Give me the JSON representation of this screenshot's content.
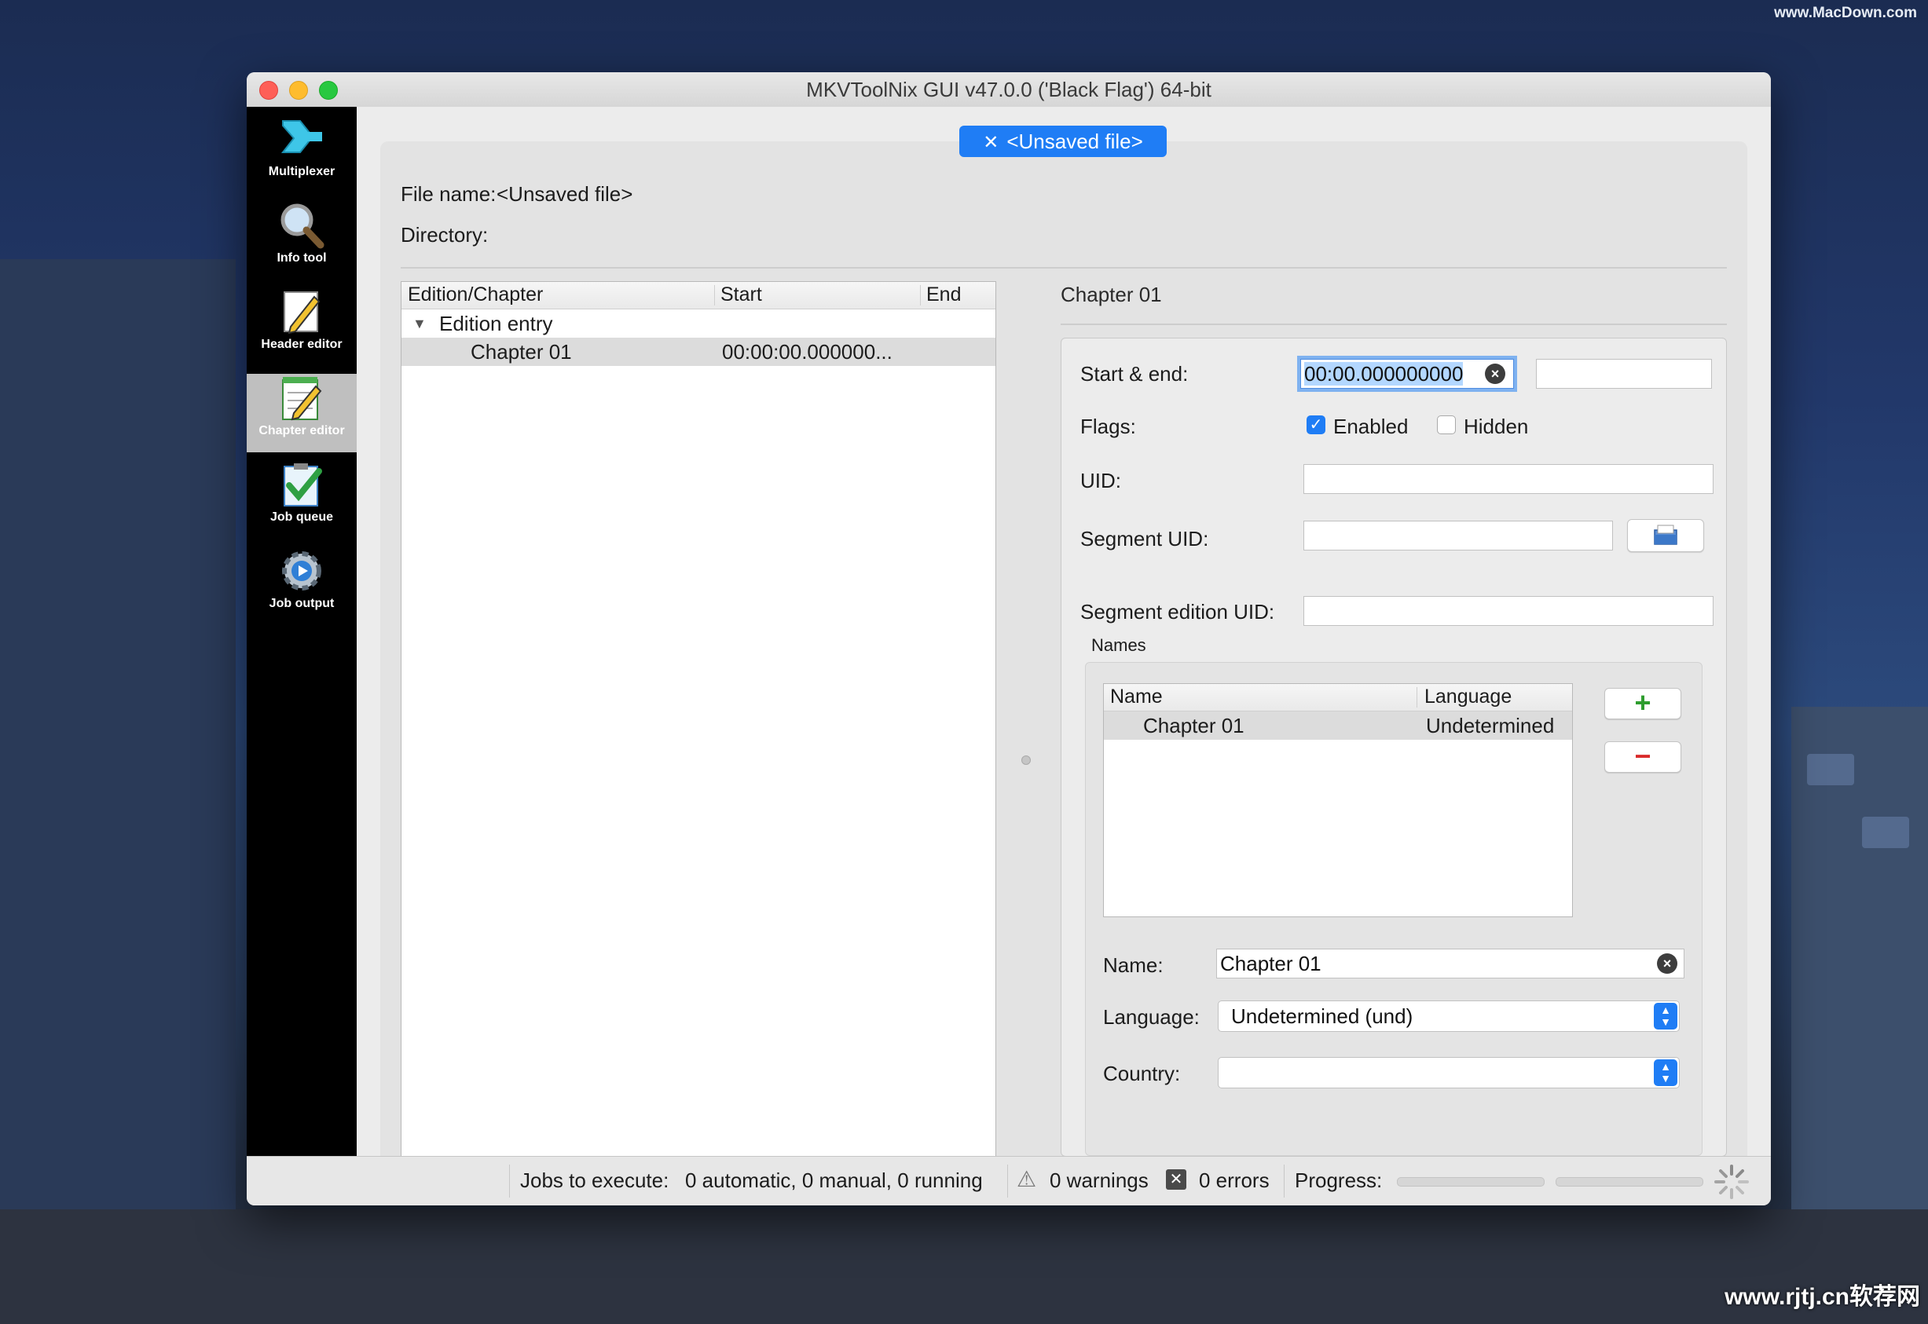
{
  "watermark": {
    "top": "www.MacDown.com",
    "bottom": "www.rjtj.cn软荐网"
  },
  "window": {
    "title": "MKVToolNix GUI v47.0.0 ('Black Flag') 64-bit"
  },
  "sidebar": {
    "items": [
      {
        "label": "Multiplexer",
        "icon": "multiplexer-icon"
      },
      {
        "label": "Info tool",
        "icon": "magnifier-icon"
      },
      {
        "label": "Header editor",
        "icon": "pencil-icon"
      },
      {
        "label": "Chapter editor",
        "icon": "notepad-pencil-icon",
        "active": true
      },
      {
        "label": "Job queue",
        "icon": "checkmark-clipboard-icon"
      },
      {
        "label": "Job output",
        "icon": "gear-play-icon"
      }
    ]
  },
  "tab": {
    "close_glyph": "✕",
    "label": "<Unsaved file>"
  },
  "file_info": {
    "file_name_label": "File name:",
    "file_name_value": "<Unsaved file>",
    "directory_label": "Directory:"
  },
  "tree": {
    "columns": [
      "Edition/Chapter",
      "Start",
      "End"
    ],
    "rows": [
      {
        "name": "Edition entry",
        "start": "",
        "end": ""
      },
      {
        "name": "Chapter 01",
        "start": "00:00:00.000000...",
        "end": ""
      }
    ]
  },
  "detail": {
    "title": "Chapter 01",
    "start_end_label": "Start & end:",
    "start_value": "00:00.000000000",
    "end_value": "",
    "flags_label": "Flags:",
    "enabled_label": "Enabled",
    "enabled_checked": true,
    "hidden_label": "Hidden",
    "hidden_checked": false,
    "uid_label": "UID:",
    "uid_value": "",
    "segment_uid_label": "Segment UID:",
    "segment_uid_value": "",
    "segment_edition_uid_label": "Segment edition UID:",
    "segment_edition_uid_value": "",
    "names_group_label": "Names",
    "names_columns": [
      "Name",
      "Language"
    ],
    "names_rows": [
      {
        "name": "Chapter 01",
        "language": "Undetermined"
      }
    ],
    "add_glyph": "+",
    "remove_glyph": "−",
    "name_label": "Name:",
    "name_value": "Chapter 01",
    "language_label": "Language:",
    "language_value": "Undetermined (und)",
    "country_label": "Country:",
    "country_value": ""
  },
  "statusbar": {
    "jobs_label": "Jobs to execute:",
    "jobs_value": "0 automatic, 0 manual, 0 running",
    "warnings": "0 warnings",
    "errors": "0 errors",
    "progress_label": "Progress:"
  },
  "colors": {
    "accent": "#1f7df5",
    "sidebar_bg": "#000000",
    "add_green": "#2e9d2e",
    "remove_red": "#d92b2b"
  }
}
